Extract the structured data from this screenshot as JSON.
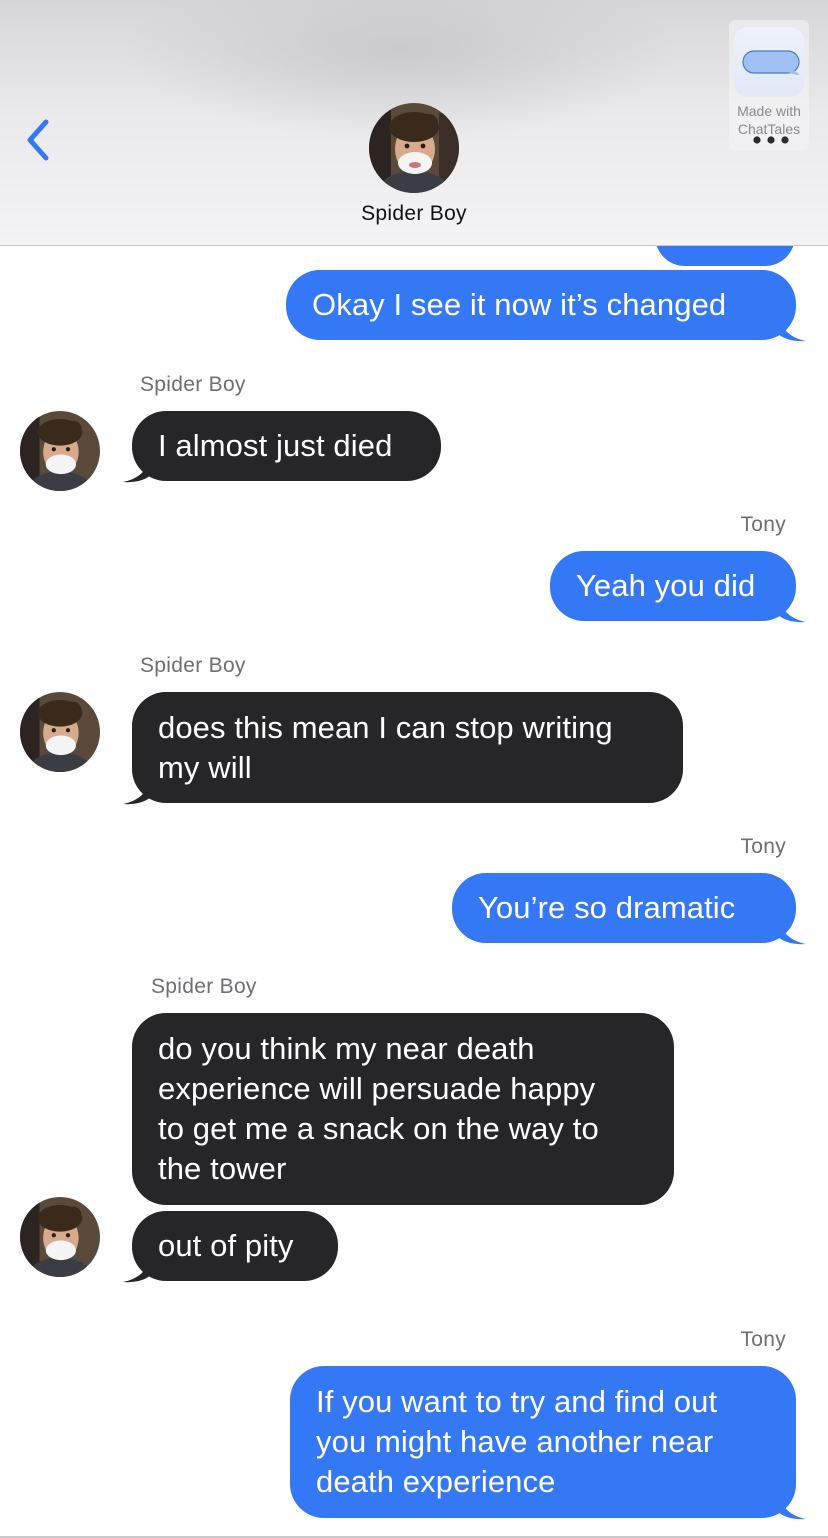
{
  "header": {
    "contact_name": "Spider Boy",
    "watermark_line1": "Made with",
    "watermark_line2": "ChatTales"
  },
  "colors": {
    "outgoing_bubble": "#3478f6",
    "incoming_bubble": "#262628",
    "accent": "#3478f6"
  },
  "messages": [
    {
      "sender": "",
      "direction": "out",
      "text": "Okay I see it now it’s changed"
    },
    {
      "sender": "Spider Boy",
      "direction": "in",
      "text": "I almost just died"
    },
    {
      "sender": "Tony",
      "direction": "out",
      "text": "Yeah you did"
    },
    {
      "sender": "Spider Boy",
      "direction": "in",
      "text_line1": "does this mean I can stop writing",
      "text_line2": "my will"
    },
    {
      "sender": "Tony",
      "direction": "out",
      "text": "You’re so dramatic"
    },
    {
      "sender": "Spider Boy",
      "direction": "in",
      "text_line1": "do you think my near death",
      "text_line2": "experience will persuade happy",
      "text_line3": "to get me a snack on the way to",
      "text_line4": "the tower"
    },
    {
      "sender": "",
      "direction": "in",
      "text": "out of pity"
    },
    {
      "sender": "Tony",
      "direction": "out",
      "text_line1": "If you want to try and find out",
      "text_line2": "you might have another near",
      "text_line3": "death experience"
    }
  ]
}
